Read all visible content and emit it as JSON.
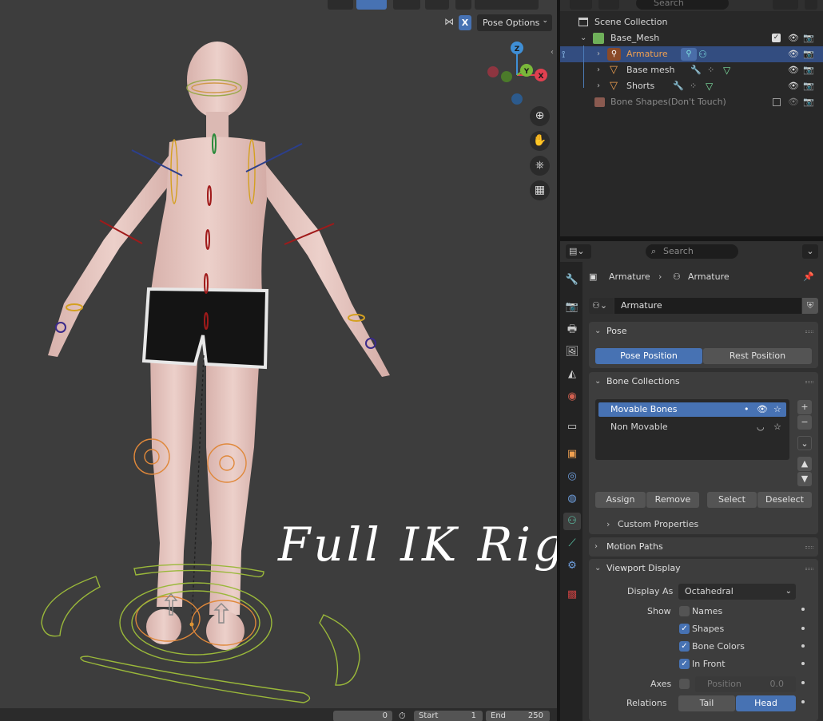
{
  "viewport": {
    "pose_options": "Pose Options",
    "x_mirror": "X",
    "handwriting": "Full IK Rig",
    "gizmo": {
      "z": "Z",
      "y": "Y",
      "x": "X"
    },
    "footer": {
      "frame": "0",
      "start_label": "Start",
      "start_value": "1",
      "end_label": "End",
      "end_value": "250"
    }
  },
  "outliner": {
    "search_placeholder": "Search",
    "items": [
      {
        "label": "Scene Collection"
      },
      {
        "label": "Base_Mesh"
      },
      {
        "label": "Armature"
      },
      {
        "label": "Base mesh"
      },
      {
        "label": "Shorts"
      },
      {
        "label": "Bone Shapes(Don't Touch)"
      }
    ]
  },
  "properties": {
    "search_placeholder": "Search",
    "breadcrumb": {
      "object": "Armature",
      "data": "Armature"
    },
    "datablock_name": "Armature",
    "pose": {
      "title": "Pose",
      "pose_position": "Pose Position",
      "rest_position": "Rest Position"
    },
    "bone_collections": {
      "title": "Bone Collections",
      "items": [
        {
          "label": "Movable Bones"
        },
        {
          "label": "Non Movable"
        }
      ],
      "assign": "Assign",
      "remove": "Remove",
      "select": "Select",
      "deselect": "Deselect",
      "custom_properties": "Custom Properties"
    },
    "motion_paths": {
      "title": "Motion Paths"
    },
    "viewport_display": {
      "title": "Viewport Display",
      "display_as_label": "Display As",
      "display_as_value": "Octahedral",
      "show_label": "Show",
      "names": "Names",
      "shapes": "Shapes",
      "bone_colors": "Bone Colors",
      "in_front": "In Front",
      "axes_label": "Axes",
      "position_label": "Position",
      "position_value": "0.0",
      "relations_label": "Relations",
      "tail": "Tail",
      "head": "Head"
    }
  },
  "colors": {
    "accent": "#4772b3",
    "selected_row": "#334d80",
    "armature_text": "#f0a050",
    "viewport_bg": "#3d3d3d"
  }
}
